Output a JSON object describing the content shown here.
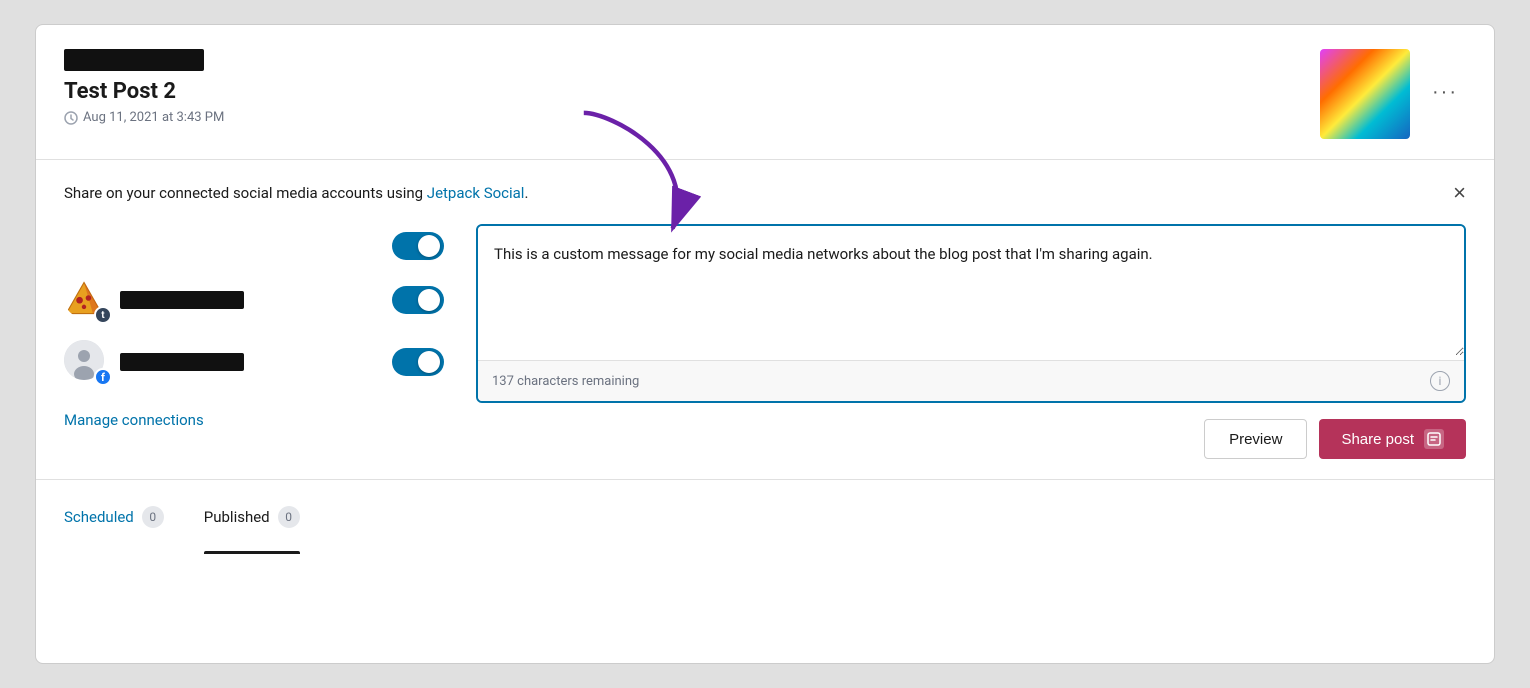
{
  "card": {
    "header": {
      "title": "Test Post 2",
      "date": "Aug 11, 2021 at 3:43 PM",
      "more_label": "···"
    },
    "share_banner": {
      "text_before_link": "Share on your connected social media accounts using ",
      "link_text": "Jetpack Social",
      "text_after_link": ".",
      "close_label": "×"
    },
    "accounts": [
      {
        "type": "tumblr",
        "redacted": true
      },
      {
        "type": "facebook",
        "redacted": true
      }
    ],
    "message": {
      "text": "This is a custom message for my social media networks about the blog post that I'm sharing again.",
      "char_remaining": "137 characters remaining"
    },
    "buttons": {
      "preview_label": "Preview",
      "share_label": "Share post"
    },
    "tabs": [
      {
        "label": "Scheduled",
        "count": "0",
        "active": true
      },
      {
        "label": "Published",
        "count": "0",
        "active": false
      }
    ]
  }
}
